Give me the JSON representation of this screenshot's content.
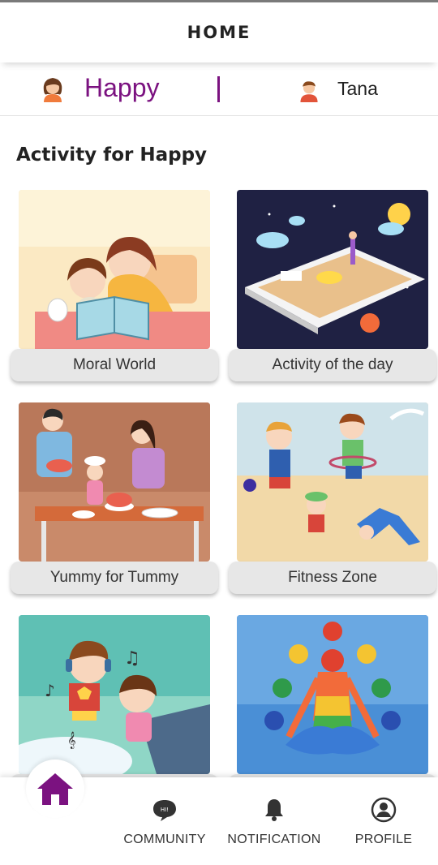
{
  "header": {
    "title": "HOME"
  },
  "userbar": {
    "mood": "Happy",
    "child_name": "Tana"
  },
  "section": {
    "title": "Activity for Happy"
  },
  "activities": [
    {
      "label": "Moral World"
    },
    {
      "label": "Activity of the day"
    },
    {
      "label": "Yummy for Tummy"
    },
    {
      "label": "Fitness Zone"
    },
    {
      "label": ""
    },
    {
      "label": ""
    }
  ],
  "nav": {
    "active": "home",
    "items": [
      {
        "label": "COMMUNITY",
        "icon": "chat-bubble-icon"
      },
      {
        "label": "NOTIFICATION",
        "icon": "bell-icon"
      },
      {
        "label": "PROFILE",
        "icon": "profile-icon"
      }
    ]
  },
  "colors": {
    "accent": "#7b1280",
    "card_label_bg": "#e7e7e7",
    "text": "#222222"
  }
}
